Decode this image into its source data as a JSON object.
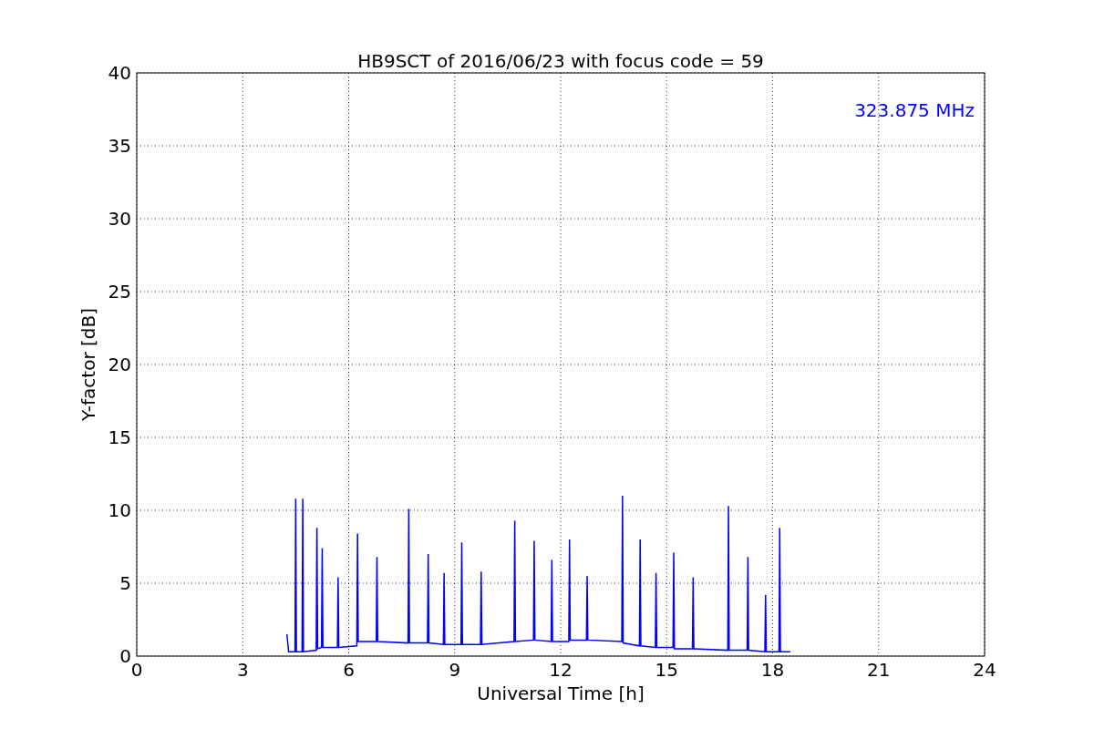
{
  "chart_data": {
    "type": "line",
    "title": "HB9SCT of 2016/06/23 with focus code = 59",
    "xlabel": "Universal Time [h]",
    "ylabel": "Y-factor [dB]",
    "x": [
      4.25,
      4.3,
      4.48,
      4.5,
      4.52,
      4.68,
      4.7,
      4.72,
      5.08,
      5.1,
      5.12,
      5.23,
      5.25,
      5.27,
      5.68,
      5.7,
      5.72,
      6.23,
      6.25,
      6.27,
      6.78,
      6.8,
      6.82,
      7.68,
      7.7,
      7.72,
      8.23,
      8.25,
      8.27,
      8.68,
      8.7,
      8.72,
      9.18,
      9.2,
      9.22,
      9.73,
      9.75,
      9.77,
      10.68,
      10.7,
      10.72,
      11.23,
      11.25,
      11.27,
      11.73,
      11.75,
      11.77,
      12.23,
      12.25,
      12.27,
      12.73,
      12.75,
      12.77,
      13.73,
      13.75,
      13.77,
      14.23,
      14.25,
      14.27,
      14.68,
      14.7,
      14.72,
      15.18,
      15.2,
      15.22,
      15.73,
      15.75,
      15.77,
      16.73,
      16.75,
      16.77,
      17.28,
      17.3,
      17.32,
      17.78,
      17.8,
      17.82,
      18.18,
      18.2,
      18.22,
      18.5
    ],
    "series": [
      {
        "name": "323.875 MHz",
        "color": "#0000ff",
        "values": [
          1.5,
          0.3,
          0.3,
          10.8,
          0.3,
          0.3,
          10.8,
          0.3,
          0.4,
          8.8,
          0.5,
          0.6,
          7.4,
          0.6,
          0.6,
          5.4,
          0.6,
          0.7,
          8.4,
          1.0,
          1.0,
          6.8,
          1.0,
          0.9,
          10.1,
          0.9,
          0.9,
          7.0,
          0.9,
          0.8,
          5.7,
          0.8,
          0.8,
          7.8,
          0.8,
          0.8,
          5.8,
          0.8,
          1.0,
          9.3,
          1.0,
          1.1,
          7.9,
          1.1,
          1.0,
          6.6,
          1.0,
          1.0,
          8.0,
          1.1,
          1.1,
          5.5,
          1.1,
          1.0,
          11.0,
          0.9,
          0.7,
          8.0,
          0.7,
          0.6,
          5.7,
          0.6,
          0.6,
          7.1,
          0.5,
          0.5,
          5.4,
          0.5,
          0.4,
          10.3,
          0.4,
          0.4,
          6.8,
          0.4,
          0.3,
          4.2,
          0.3,
          0.3,
          8.8,
          0.3,
          0.3
        ]
      }
    ],
    "xlim": [
      0,
      24
    ],
    "ylim": [
      0,
      40
    ],
    "xticks": [
      0,
      3,
      6,
      9,
      12,
      15,
      18,
      21,
      24
    ],
    "yticks": [
      0,
      5,
      10,
      15,
      20,
      25,
      30,
      35,
      40
    ],
    "grid": true
  }
}
